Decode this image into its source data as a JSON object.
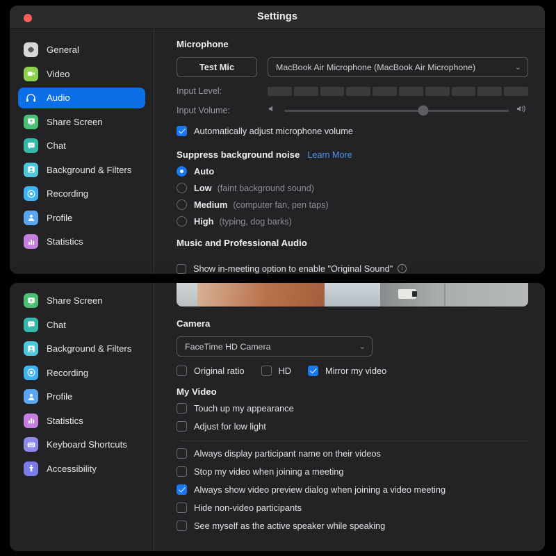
{
  "window_audio": {
    "title": "Settings",
    "traffic_light_color": "#ff5f57",
    "sidebar": [
      {
        "label": "General",
        "icon": "gear-icon",
        "color": "#d8d8d8",
        "active": false
      },
      {
        "label": "Video",
        "icon": "video-camera-icon",
        "color": "#8fd14f",
        "active": false
      },
      {
        "label": "Audio",
        "icon": "headphones-icon",
        "color": "#0b6fe8",
        "active": true
      },
      {
        "label": "Share Screen",
        "icon": "share-screen-icon",
        "color": "#4cbf74",
        "active": false
      },
      {
        "label": "Chat",
        "icon": "chat-bubble-icon",
        "color": "#36b9a8",
        "active": false
      },
      {
        "label": "Background & Filters",
        "icon": "person-frame-icon",
        "color": "#4fc7dd",
        "active": false
      },
      {
        "label": "Recording",
        "icon": "record-circle-icon",
        "color": "#3fb4f2",
        "active": false
      },
      {
        "label": "Profile",
        "icon": "person-icon",
        "color": "#5aa6f0",
        "active": false
      },
      {
        "label": "Statistics",
        "icon": "bar-chart-icon",
        "color": "#c47ee0",
        "active": false
      }
    ],
    "microphone": {
      "heading": "Microphone",
      "test_mic_label": "Test Mic",
      "device_value": "MacBook Air Microphone (MacBook Air Microphone)",
      "chevron": "⌄",
      "input_level_label": "Input Level:",
      "input_level_segments": 10,
      "input_level_value": 0,
      "input_volume_label": "Input Volume:",
      "input_volume_percent": 62,
      "auto_adjust": {
        "label": "Automatically adjust microphone volume",
        "checked": true
      }
    },
    "suppress_noise": {
      "heading": "Suppress background noise",
      "learn_more": "Learn More",
      "options": [
        {
          "label": "Auto",
          "hint": "",
          "selected": true
        },
        {
          "label": "Low",
          "hint": "(faint background sound)",
          "selected": false
        },
        {
          "label": "Medium",
          "hint": "(computer fan, pen taps)",
          "selected": false
        },
        {
          "label": "High",
          "hint": "(typing, dog barks)",
          "selected": false
        }
      ]
    },
    "music_audio": {
      "heading": "Music and Professional Audio",
      "clipped_option": "Show in-meeting option to enable \"Original Sound\"",
      "clipped_checked": false
    }
  },
  "window_video": {
    "sidebar": [
      {
        "label": "Share Screen",
        "icon": "share-screen-icon",
        "color": "#4cbf74",
        "active": false
      },
      {
        "label": "Chat",
        "icon": "chat-bubble-icon",
        "color": "#36b9a8",
        "active": false
      },
      {
        "label": "Background & Filters",
        "icon": "person-frame-icon",
        "color": "#4fc7dd",
        "active": false
      },
      {
        "label": "Recording",
        "icon": "record-circle-icon",
        "color": "#3fb4f2",
        "active": false
      },
      {
        "label": "Profile",
        "icon": "person-icon",
        "color": "#5aa6f0",
        "active": false
      },
      {
        "label": "Statistics",
        "icon": "bar-chart-icon",
        "color": "#c47ee0",
        "active": false
      },
      {
        "label": "Keyboard Shortcuts",
        "icon": "keyboard-icon",
        "color": "#8d8ae8",
        "active": false
      },
      {
        "label": "Accessibility",
        "icon": "accessibility-icon",
        "color": "#7b7ce8",
        "active": false
      }
    ],
    "camera": {
      "heading": "Camera",
      "device_value": "FaceTime HD Camera",
      "chevron": "⌄",
      "options": [
        {
          "label": "Original ratio",
          "checked": false
        },
        {
          "label": "HD",
          "checked": false
        },
        {
          "label": "Mirror my video",
          "checked": true
        }
      ]
    },
    "my_video": {
      "heading": "My Video",
      "options": [
        {
          "label": "Touch up my appearance",
          "checked": false
        },
        {
          "label": "Adjust for low light",
          "checked": false
        }
      ]
    },
    "general_options": [
      {
        "label": "Always display participant name on their videos",
        "checked": false
      },
      {
        "label": "Stop my video when joining a meeting",
        "checked": false
      },
      {
        "label": "Always show video preview dialog when joining a video meeting",
        "checked": true
      },
      {
        "label": "Hide non-video participants",
        "checked": false
      },
      {
        "label": "See myself as the active speaker while speaking",
        "checked": false
      }
    ]
  },
  "theme": {
    "accent": "#1878f2",
    "active_nav": "#0b6fe8",
    "link": "#4a93f2",
    "window_bg": "#232325",
    "titlebar_bg": "#2b2b2d"
  }
}
